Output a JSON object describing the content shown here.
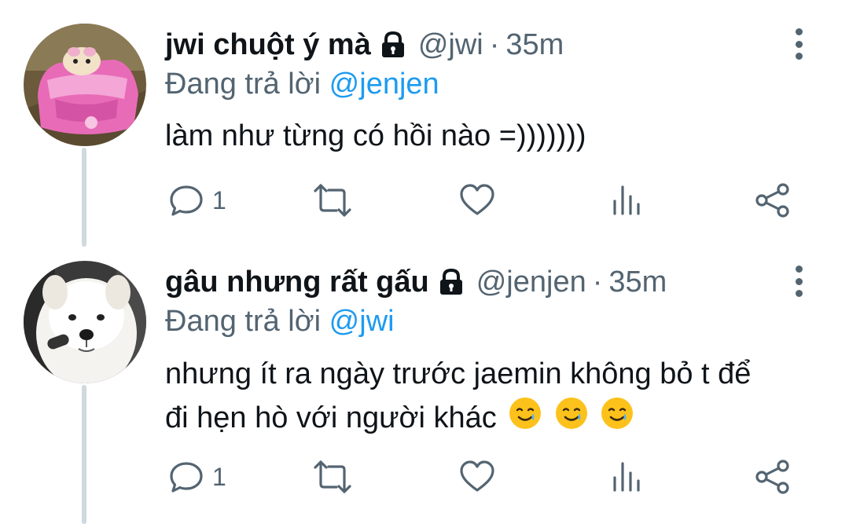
{
  "tweets": [
    {
      "name": "jwi chuột ý mà",
      "handle": "@jwi",
      "separator": "·",
      "time": "35m",
      "reply_prefix": "Đang trả lời",
      "reply_to": "@jenjen",
      "text_lines": [
        "làm như từng có hồi nào =)))))))"
      ],
      "emojis": [],
      "reply_count": "1",
      "avatar": "pink-toy-car-hamster",
      "protected_icon": "lock-icon"
    },
    {
      "name": "gâu nhưng rất gấu",
      "handle": "@jenjen",
      "separator": "·",
      "time": "35m",
      "reply_prefix": "Đang trả lời",
      "reply_to": "@jwi",
      "text_lines": [
        "nhưng ít ra ngày trước jaemin không bỏ t để",
        "đi hẹn hò với người khác"
      ],
      "emojis": [
        "smiling-face-with-tear",
        "smiling-face-with-tear",
        "smiling-face-with-tear"
      ],
      "reply_count": "1",
      "avatar": "white-samoyed-dog",
      "protected_icon": "lock-icon"
    }
  ],
  "colors": {
    "text": "#0f1419",
    "secondary": "#536471",
    "link": "#1d9bf0",
    "thread_line": "#cfd9de"
  }
}
